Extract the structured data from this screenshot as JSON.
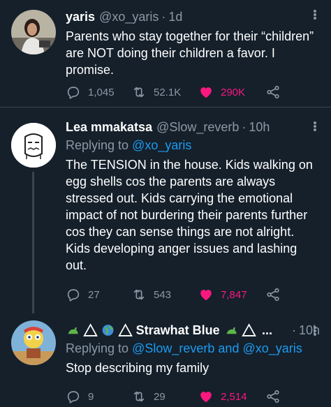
{
  "tweets": [
    {
      "name": "yaris",
      "handle": "@xo_yaris",
      "separator": "·",
      "time": "1d",
      "text": "Parents who stay together for their “children” are NOT doing their children a favor. I promise.",
      "replies": "1,045",
      "retweets": "52.1K",
      "likes": "290K",
      "liked": true,
      "avatar_icon": "person-photo"
    },
    {
      "name": "Lea mmakatsa",
      "handle": "@Slow_reverb",
      "separator": "·",
      "time": "10h",
      "replying_prefix": "Replying to",
      "replying_to": "@xo_yaris",
      "text": "The TENSION in the house. Kids walking on egg shells cos the parents are always stressed out. Kids carrying the emotional impact of not burdering their parents further cos they can sense things are not alright. Kids developing anger issues and lashing out.",
      "replies": "27",
      "retweets": "543",
      "likes": "7,847",
      "liked": true,
      "avatar_icon": "doodle-face"
    },
    {
      "name": "Strawhat Blue",
      "name_ellipsis": "...",
      "separator": "·",
      "time": "10h",
      "replying_prefix": "Replying to",
      "replying_to": "@Slow_reverb",
      "replying_and": "and",
      "replying_to_2": "@xo_yaris",
      "text": "Stop describing my family",
      "replies": "9",
      "retweets": "29",
      "likes": "2,514",
      "liked": true,
      "avatar_icon": "cartoon-character"
    }
  ],
  "colors": {
    "background": "#15202b",
    "secondary_text": "#8b98a5",
    "link": "#1d9bf0",
    "like": "#f91880",
    "divider": "#38444d"
  }
}
